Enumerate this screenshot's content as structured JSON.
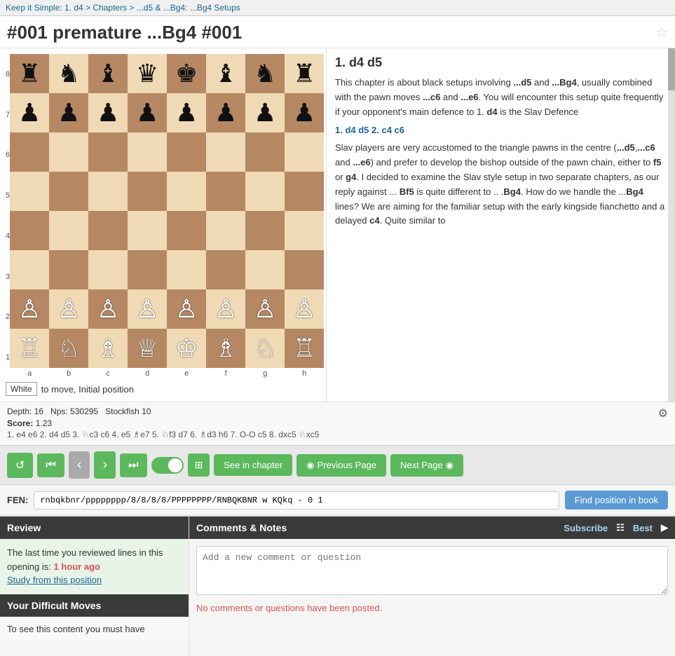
{
  "nav": {
    "breadcrumb": "Keep it Simple: 1. d4 > Chapters > ...d5 & ...Bg4: ...Bg4 Setups"
  },
  "header": {
    "title": "#001 premature ...Bg4 #001"
  },
  "move_heading": "1. d4  d5",
  "text_content": [
    "This chapter is about black setups involving ...d5 and ...Bg4, usually combined with the pawn moves ...c6 and ...e6. You will encounter this setup quite frequently if your opponent's main defence to 1. d4 is the Slav Defence",
    "MOVE_LINE:1. d4 d5 2. c4 c6",
    "Slav players are very accustomed to the triangle pawns in the centre (...d5,...c6 and ...e6) and prefer to develop the bishop outside of the pawn chain, either to f5 or g4. I decided to examine the Slav style setup in two separate chapters, as our reply against ... Bf5 is quite different to .. .Bg4. How do we handle the ...Bg4 lines? We are aiming for the familiar setup with the early kingside fianchetto and a delayed c4. Quite similar to"
  ],
  "engine": {
    "depth": "Depth: 16",
    "nps": "Nps: 530295",
    "engine_name": "Stockfish 10",
    "score_label": "Score:",
    "score_value": "1.23",
    "moves": "1. e4 e6 2. d4 d5 3. ♘c3 c6 4. e5 ♗e7 5. ♘f3 d7 6. ♗d3 h6 7. O-O c5 8. dxc5 ♘xc5"
  },
  "controls": {
    "restart_label": "↺",
    "start_label": "⏮",
    "prev_label": "‹",
    "next_label": "›",
    "end_label": "⏭",
    "see_in_chapter": "See in chapter",
    "prev_page": "Previous Page",
    "next_page": "Next Page"
  },
  "fen": {
    "label": "FEN:",
    "value": "rnbqkbnr/pppppppp/8/8/8/8/PPPPPPPP/RNBQKBNR w KQkq - 0 1",
    "find_btn": "Find position in book"
  },
  "board_status": {
    "white": "White",
    "status": "to move, Initial position"
  },
  "board_labels": {
    "ranks": [
      "8",
      "7",
      "6",
      "5",
      "4",
      "3",
      "2",
      "1"
    ],
    "files": [
      "a",
      "b",
      "c",
      "d",
      "e",
      "f",
      "g",
      "h"
    ]
  },
  "review": {
    "header": "Review",
    "content": "The last time you reviewed lines in this opening is:",
    "time_highlight": "1 hour ago",
    "study_link": "Study from this position"
  },
  "difficult_moves": {
    "header": "Your Difficult Moves",
    "content": "To see this content you must have"
  },
  "comments": {
    "header": "Comments & Notes",
    "subscribe": "Subscribe",
    "best": "Best",
    "placeholder": "Add a new comment or question",
    "no_comments": "No comments or questions have been posted."
  }
}
